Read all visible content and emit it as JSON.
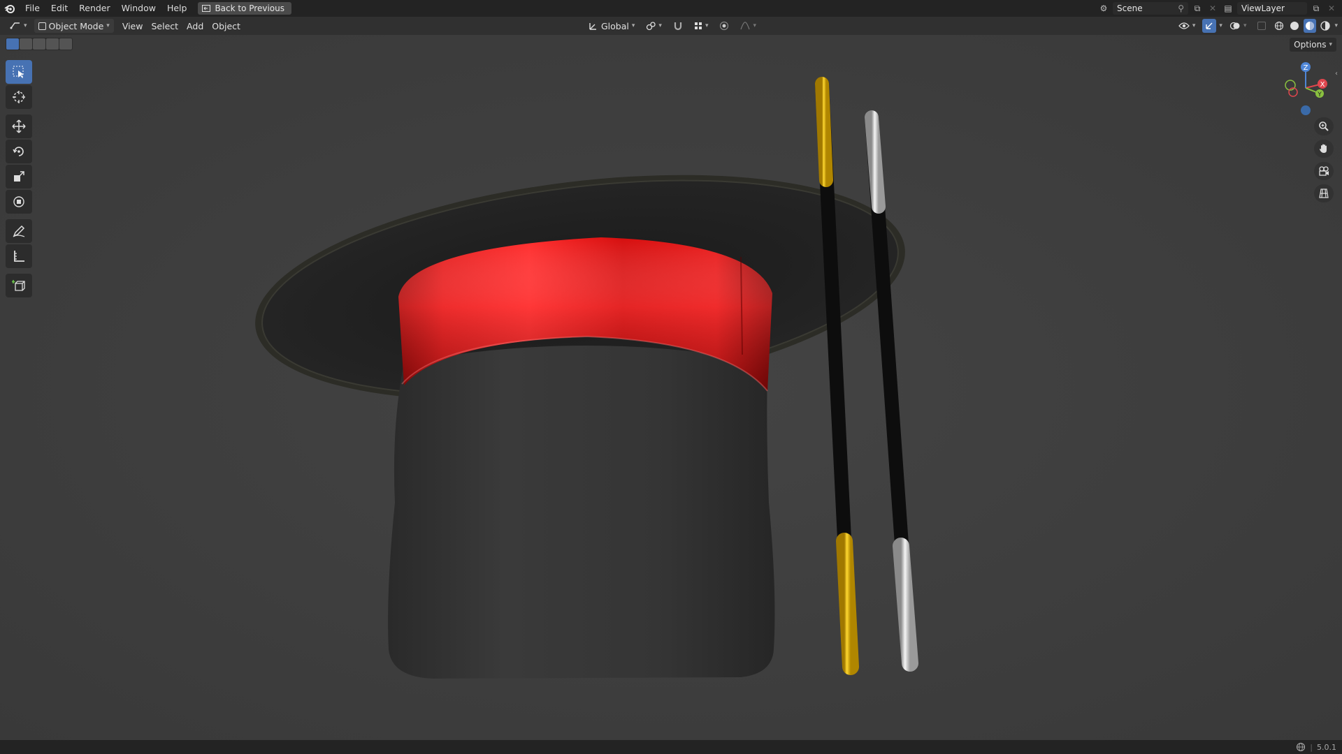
{
  "menubar": {
    "items": [
      "File",
      "Edit",
      "Render",
      "Window",
      "Help"
    ],
    "back_label": "Back to Previous",
    "scene_name": "Scene",
    "view_layer": "ViewLayer"
  },
  "header": {
    "mode": "Object Mode",
    "menus": [
      "View",
      "Select",
      "Add",
      "Object"
    ],
    "transform_orientation": "Global"
  },
  "viewport": {
    "options_label": "Options",
    "gizmo_axes": {
      "z": "Z",
      "x": "X",
      "y": "Y"
    }
  },
  "status": {
    "version": "5.0.1"
  },
  "colors": {
    "accent": "#4772b3",
    "background": "#3d3d3d",
    "ribbon": "#e30d0d",
    "gold": "#f0c020",
    "silver": "#d8d8d8"
  }
}
